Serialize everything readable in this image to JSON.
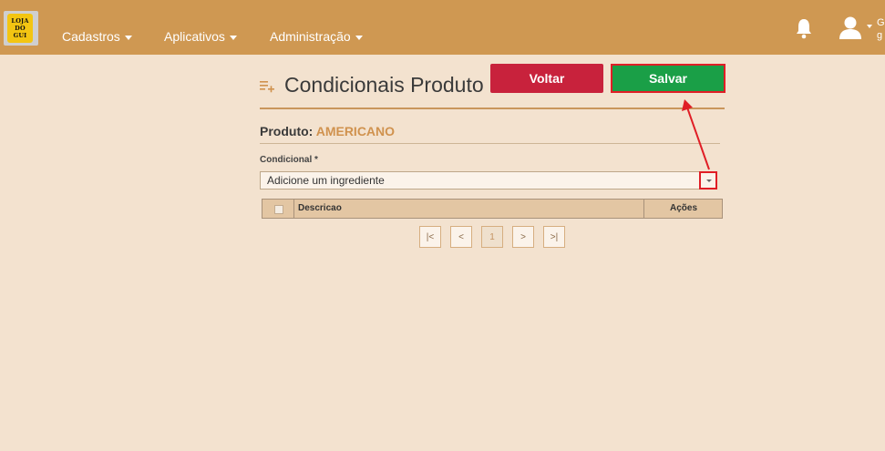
{
  "navbar": {
    "logo_lines": [
      "LOJA",
      "DO",
      "GUI"
    ],
    "items": [
      {
        "label": "Cadastros"
      },
      {
        "label": "Aplicativos"
      },
      {
        "label": "Administração"
      }
    ],
    "user_name_lines": [
      "G",
      "g"
    ],
    "icons": {
      "notifications": "bell-icon",
      "user": "user-icon"
    }
  },
  "page": {
    "title": "Condicionais Produto",
    "title_icon": "list-add-icon",
    "back_label": "Voltar",
    "save_label": "Salvar"
  },
  "produto": {
    "label": "Produto:",
    "value": "AMERICANO"
  },
  "condicional": {
    "label": "Condicional *",
    "placeholder": "Adicione um ingrediente"
  },
  "table": {
    "columns": [
      "Descricao",
      "Ações"
    ],
    "rows": []
  },
  "pagination": {
    "first": "|<",
    "prev": "<",
    "current": "1",
    "next": ">",
    "last": ">|"
  },
  "colors": {
    "navbar": "#cf9852",
    "background": "#f3e2cf",
    "back_button": "#c8223c",
    "save_button": "#1a9f47",
    "accent": "#d0924e",
    "annotation": "#e01e26"
  }
}
